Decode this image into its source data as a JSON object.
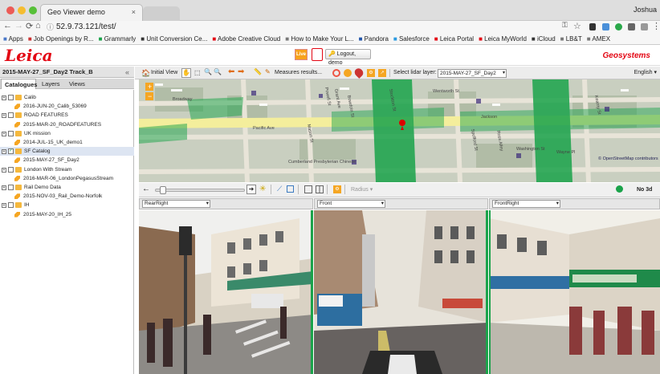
{
  "browser": {
    "tab_title": "Geo Viewer demo",
    "tab_close": "×",
    "user": "Joshua",
    "url": "52.9.73.121/test/",
    "bookmarks": [
      {
        "icon": "grid-icon",
        "label": "Apps"
      },
      {
        "icon": "heart-icon",
        "label": "Job Openings by R..."
      },
      {
        "icon": "g-icon",
        "label": "Grammarly"
      },
      {
        "icon": "hourglass-icon",
        "label": "Unit Conversion Ce..."
      },
      {
        "icon": "adobe-icon",
        "label": "Adobe Creative Cloud"
      },
      {
        "icon": "page-icon",
        "label": "How to Make Your L..."
      },
      {
        "icon": "pandora-icon",
        "label": "Pandora"
      },
      {
        "icon": "salesforce-icon",
        "label": "Salesforce"
      },
      {
        "icon": "leica-icon",
        "label": "Leica Portal"
      },
      {
        "icon": "leica-icon",
        "label": "Leica MyWorld"
      },
      {
        "icon": "apple-icon",
        "label": "iCloud"
      },
      {
        "icon": "page-icon",
        "label": "LB&T"
      },
      {
        "icon": "page-icon",
        "label": "AMEX"
      }
    ]
  },
  "header": {
    "logo": "Leica",
    "live": "Live",
    "logout": "Logout, demo",
    "brand": "Geosystems"
  },
  "panel": {
    "title": "2015-MAY-27_SF_Day2 Track_B",
    "collapse": "«",
    "tabs": [
      "Catalogues",
      "Layers",
      "Views"
    ],
    "tree": [
      {
        "level": 0,
        "label": "Calib",
        "expand": "+"
      },
      {
        "level": 1,
        "label": "2016-JUN-20_Calib_53069"
      },
      {
        "level": 0,
        "label": "ROAD FEATURES",
        "expand": "+"
      },
      {
        "level": 1,
        "label": "2015-MAR-20_ROADFEATURES"
      },
      {
        "level": 0,
        "label": "UK mission",
        "expand": "+"
      },
      {
        "level": 1,
        "label": "2014-JUL-15_UK_demo1"
      },
      {
        "level": 0,
        "label": "SF Catalog",
        "expand": "+",
        "checked": true,
        "selected": true
      },
      {
        "level": 1,
        "label": "2015-MAY-27_SF_Day2"
      },
      {
        "level": 0,
        "label": "London With Stream",
        "expand": "+"
      },
      {
        "level": 1,
        "label": "2016-MAR-06_LondonPegasusStream"
      },
      {
        "level": 0,
        "label": "Rail Demo Data",
        "expand": "+"
      },
      {
        "level": 1,
        "label": "2015-NOV-03_Rail_Demo-Norfolk"
      },
      {
        "level": 0,
        "label": "IH",
        "expand": "+"
      },
      {
        "level": 1,
        "label": "2015-MAY-20_IH_25"
      }
    ]
  },
  "toolbar": {
    "initial_view": "Initial View",
    "measures": "Measures results...",
    "lidar_label": "Select lidar layer:",
    "lidar_value": "2015-MAY-27_SF_Day2",
    "language": "English"
  },
  "map": {
    "streets": [
      "Broadway",
      "Pacific Ave",
      "Wentworth St",
      "Jackson",
      "Washington St",
      "Bowdoin St",
      "Grant Ave",
      "Stockton St",
      "Powell St",
      "Kearny St",
      "Mason St",
      "Cumberland Presbyterian Chinese",
      "Spofford St",
      "Ross Alley",
      "Wayne Pl"
    ],
    "attribution": "© OpenStreetMap contributors"
  },
  "viewer": {
    "radius": "Radius",
    "nod3d": "No 3d",
    "views": [
      "RearRight",
      "Front",
      "FrontRight"
    ]
  },
  "colors": {
    "leica_red": "#e30613",
    "point_green": "#1aa34a",
    "selected_row": "#dde5f2"
  }
}
